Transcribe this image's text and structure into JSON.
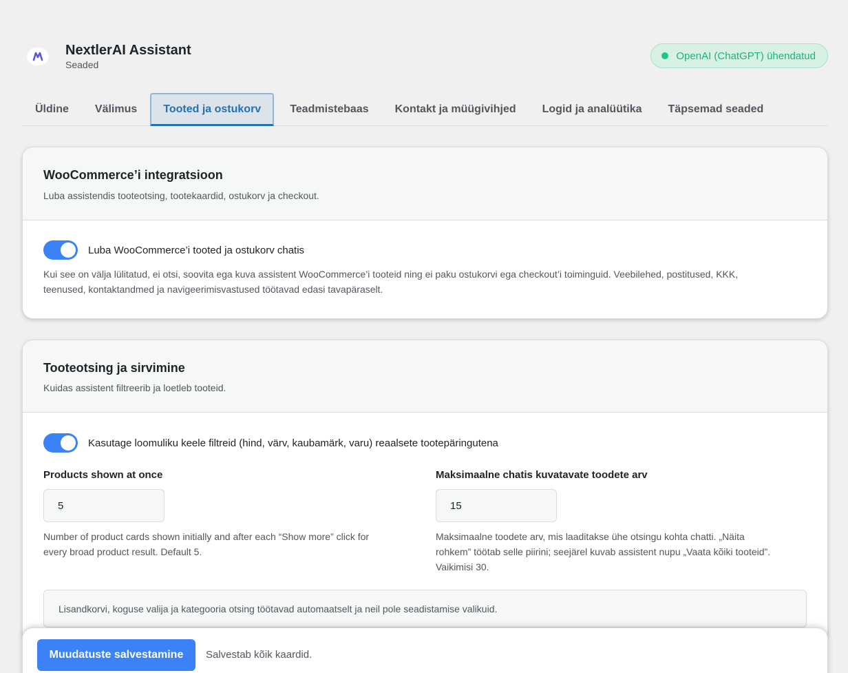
{
  "app": {
    "title": "NextlerAI Assistant",
    "subtitle": "Seaded",
    "status": "OpenAI (ChatGPT) ühendatud",
    "accent_color": "#3b82f6",
    "status_color": "#1eb377"
  },
  "tabs": [
    {
      "label": "Üldine",
      "active": false
    },
    {
      "label": "Välimus",
      "active": false
    },
    {
      "label": "Tooted ja ostukorv",
      "active": true
    },
    {
      "label": "Teadmistebaas",
      "active": false
    },
    {
      "label": "Kontakt ja müügivihjed",
      "active": false
    },
    {
      "label": "Logid ja analüütika",
      "active": false
    },
    {
      "label": "Täpsemad seaded",
      "active": false
    }
  ],
  "woo_card": {
    "title": "WooCommerce’i integratsioon",
    "description": "Luba assistendis tooteotsing, tootekaardid, ostukorv ja checkout.",
    "toggle_label": "Luba WooCommerce’i tooted ja ostukorv chatis",
    "toggle_on": true,
    "help_line1": "Kui see on välja lülitatud, ei otsi, soovita ega kuva assistent WooCommerce’i tooteid ning ei paku ostukorvi ega checkout’i toiminguid. Veebilehed, postitused, KKK,",
    "help_line2": "teenused, kontaktandmed ja navigeerimisvastused töötavad edasi tavapäraselt."
  },
  "search_card": {
    "title": "Tooteotsing ja sirvimine",
    "description": "Kuidas assistent filtreerib ja loetleb tooteid.",
    "toggle_label": "Kasutage loomuliku keele filtreid (hind, värv, kaubamärk, varu) reaalsete tootepäringutena",
    "toggle_on": true,
    "products_shown": {
      "label": "Products shown at once",
      "value": "5",
      "help_line1": "Number of product cards shown initially and after each “Show more” click for",
      "help_line2": "every broad product result. Default 5."
    },
    "max_products": {
      "label": "Maksimaalne chatis kuvatavate toodete arv",
      "value": "15",
      "help_line1": "Maksimaalne toodete arv, mis laaditakse ühe otsingu kohta chatti. „Näita",
      "help_line2": "rohkem” töötab selle piirini; seejärel kuvab assistent nupu „Vaata kõiki tooteid”.",
      "help_line3": "Vaikimisi 30."
    },
    "notice": "Lisandkorvi, koguse valija ja kategooria otsing töötavad automaatselt ja neil pole seadistamise valikuid."
  },
  "savebar": {
    "button_label": "Muudatuste salvestamine",
    "note": "Salvestab kõik kaardid."
  },
  "icons": {
    "logo": "nextlerai-logo-icon",
    "status": "status-dot-icon"
  }
}
